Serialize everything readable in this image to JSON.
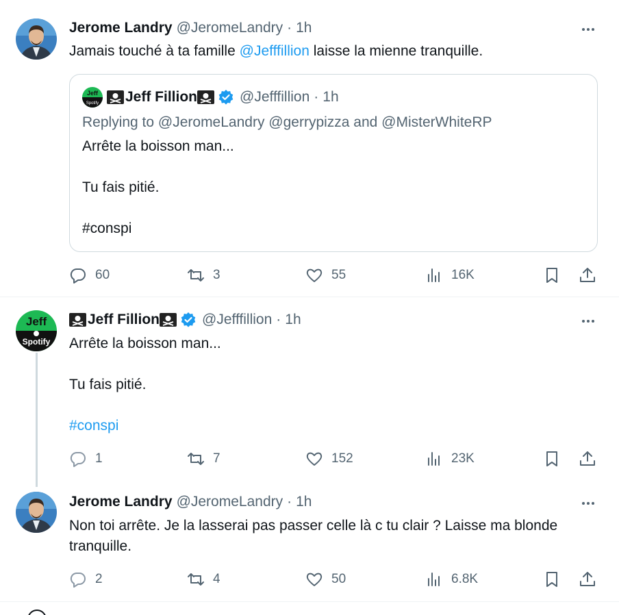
{
  "tweets": [
    {
      "name": "Jerome Landry",
      "handle": "@JeromeLandry",
      "separator": "·",
      "time": "1h",
      "text_before": "Jamais touché à ta famille ",
      "mention": "@Jefffillion",
      "text_after": " laisse la mienne tranquille.",
      "quote": {
        "name": "Jeff Fillion",
        "handle": "@Jefffillion",
        "time": "1h",
        "replying": "Replying to @JeromeLandry @gerrypizza and @MisterWhiteRP",
        "line1": "Arrête la boisson man...",
        "line2": "Tu fais pitié.",
        "line3": "#conspi"
      },
      "stats": {
        "replies": "60",
        "retweets": "3",
        "likes": "55",
        "views": "16K"
      }
    },
    {
      "name": "Jeff Fillion",
      "handle": "@Jefffillion",
      "separator": "·",
      "time": "1h",
      "line1": "Arrête la boisson man...",
      "line2": "Tu fais pitié.",
      "hashtag": "#conspi",
      "avatar_text_top": "Jeff",
      "avatar_text_bottom": "Spotify",
      "stats": {
        "replies": "1",
        "retweets": "7",
        "likes": "152",
        "views": "23K"
      }
    },
    {
      "name": "Jerome Landry",
      "handle": "@JeromeLandry",
      "separator": "·",
      "time": "1h",
      "text": "Non toi arrête. Je la lasserai pas passer celle là c tu clair ? Laisse ma blonde tranquille.",
      "stats": {
        "replies": "2",
        "retweets": "4",
        "likes": "50",
        "views": "6.8K"
      }
    }
  ],
  "colors": {
    "link": "#1d9bf0",
    "verified": "#1d9bf0",
    "muted": "#536471",
    "border": "#cfd9de"
  },
  "icons": [
    "reply-icon",
    "retweet-icon",
    "like-icon",
    "views-icon",
    "bookmark-icon",
    "share-icon",
    "more-icon",
    "verified-icon",
    "pirate-flag-icon"
  ]
}
